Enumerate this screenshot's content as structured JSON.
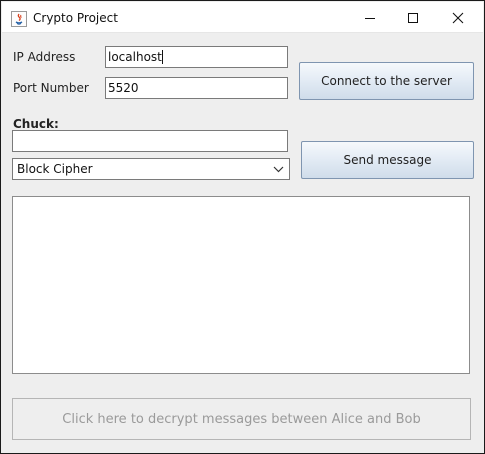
{
  "window": {
    "title": "Crypto Project",
    "app_icon": "java-icon",
    "controls": [
      "minimize-icon",
      "maximize-icon",
      "close-icon"
    ]
  },
  "connection": {
    "ip_label": "IP Address",
    "ip_value": "localhost",
    "port_label": "Port Number",
    "port_value": "5520",
    "connect_button": "Connect to the server"
  },
  "message": {
    "user_label": "Chuck:",
    "message_value": "",
    "cipher_selected": "Block Cipher",
    "send_button": "Send message"
  },
  "log": {
    "content": ""
  },
  "decrypt": {
    "button_label": "Click here to decrypt messages between Alice and Bob",
    "enabled": false
  }
}
